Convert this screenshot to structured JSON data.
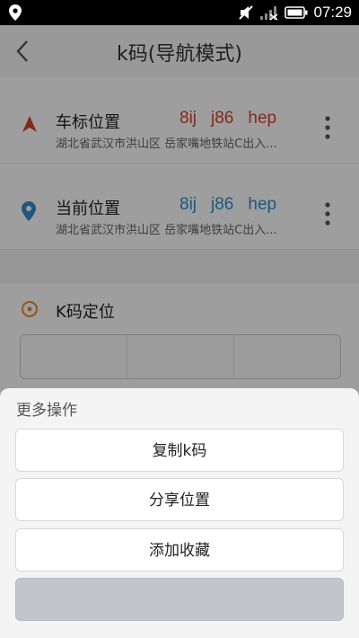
{
  "status_bar": {
    "time": "07:29"
  },
  "header": {
    "title": "k码(导航模式)"
  },
  "locations": [
    {
      "name": "车标位置",
      "codes": [
        "8ij",
        "j86",
        "hep"
      ],
      "address": "湖北省武汉市洪山区 岳家嘴地铁站C出入...",
      "icon": "car-marker-icon",
      "color": "#d6422f"
    },
    {
      "name": "当前位置",
      "codes": [
        "8ij",
        "j86",
        "hep"
      ],
      "address": "湖北省武汉市洪山区 岳家嘴地铁站C出入...",
      "icon": "location-pin-icon",
      "color": "#2f8fce"
    }
  ],
  "kcode_section": {
    "label": "K码定位",
    "icon": "target-icon"
  },
  "sheet": {
    "title": "更多操作",
    "actions": [
      {
        "label": "复制k码"
      },
      {
        "label": "分享位置"
      },
      {
        "label": "添加收藏"
      }
    ],
    "cancel_label": ""
  }
}
